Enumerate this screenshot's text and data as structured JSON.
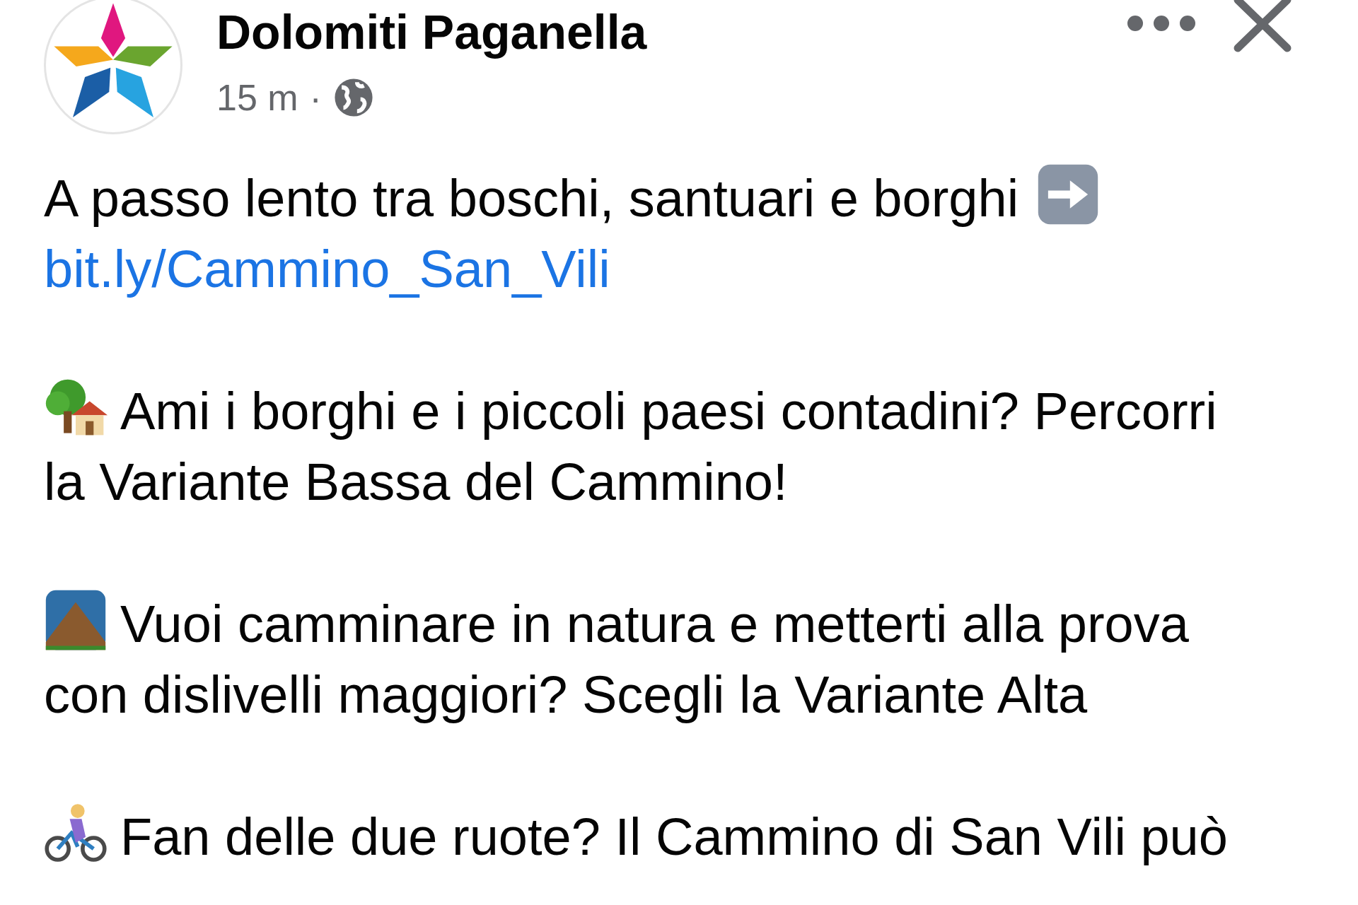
{
  "post": {
    "author": "Dolomiti Paganella",
    "time": "15 m",
    "separator": "·"
  },
  "paragraphs": [
    {
      "lines": [
        "A passo lento tra boschi, santuari e borghi"
      ],
      "link": "bit.ly/Cammino_San_Vili"
    },
    {
      "lines": [
        "Ami i borghi e i piccoli paesi contadini? Percorri",
        "la Variante Bassa del Cammino!"
      ]
    },
    {
      "lines": [
        "Vuoi camminare in natura e metterti alla prova",
        "con dislivelli maggiori? Scegli la Variante Alta"
      ]
    },
    {
      "lines": [
        "Fan delle due ruote? Il Cammino di San Vili può"
      ]
    }
  ]
}
